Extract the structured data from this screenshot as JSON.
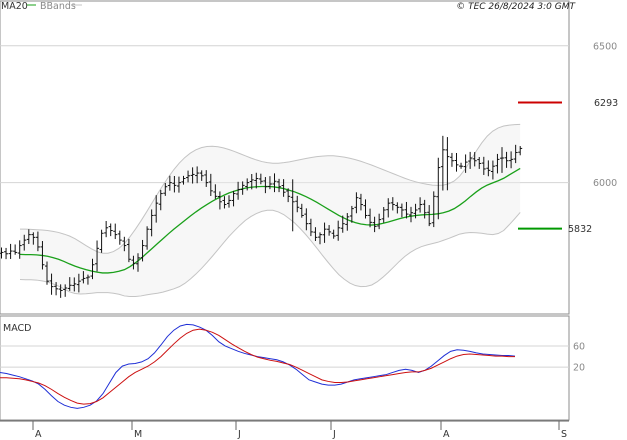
{
  "header": {
    "ma_label": "MA20",
    "bb_label": "BBands",
    "copyright": "© TEC 26/8/2024 3:0 GMT"
  },
  "colors": {
    "price": "#111111",
    "ma": "#1aa01a",
    "bands": "#c4c4c4",
    "band_fill": "#eeeeee",
    "resistance": "#cc0000",
    "support": "#009900",
    "macd": "#1f2fd6",
    "signal": "#cc1111",
    "grid": "#d4d4d4"
  },
  "chart_data": [
    {
      "type": "ohlc",
      "title": "",
      "y_ticks": [
        "6500",
        "6000"
      ],
      "ylim": [
        5520,
        6660
      ],
      "x_ticks": [
        "A",
        "M",
        "J",
        "J",
        "A",
        "S"
      ],
      "levels": [
        {
          "label": "6293",
          "value": 6293,
          "kind": "resistance"
        },
        {
          "label": "5832",
          "value": 5832,
          "kind": "support"
        }
      ],
      "series": [
        {
          "name": "price",
          "values": [
            5745,
            5740,
            5750,
            5745,
            5770,
            5790,
            5810,
            5800,
            5765,
            5700,
            5640,
            5620,
            5612,
            5606,
            5615,
            5625,
            5630,
            5640,
            5650,
            5655,
            5700,
            5760,
            5815,
            5835,
            5825,
            5810,
            5790,
            5770,
            5720,
            5705,
            5725,
            5770,
            5830,
            5880,
            5925,
            5960,
            5985,
            6000,
            5990,
            6000,
            6015,
            6025,
            6030,
            6035,
            6025,
            6000,
            5970,
            5950,
            5930,
            5920,
            5935,
            5960,
            5975,
            5990,
            6000,
            6010,
            6015,
            6005,
            5985,
            5995,
            6005,
            5985,
            5965,
            5950,
            5930,
            5910,
            5880,
            5850,
            5820,
            5800,
            5810,
            5830,
            5820,
            5805,
            5835,
            5850,
            5875,
            5905,
            5945,
            5920,
            5880,
            5855,
            5840,
            5865,
            5900,
            5925,
            5920,
            5910,
            5900,
            5885,
            5890,
            5900,
            5920,
            5890,
            5850,
            5950,
            6055,
            6120,
            6095,
            6080,
            6065,
            6060,
            6075,
            6090,
            6080,
            6070,
            6050,
            6045,
            6060,
            6085,
            6090,
            6080,
            6085,
            6110,
            6125
          ]
        },
        {
          "name": "MA20",
          "values": [
            5738,
            5737,
            5737,
            5736,
            5734,
            5731,
            5726,
            5720,
            5712,
            5703,
            5695,
            5688,
            5682,
            5677,
            5673,
            5670,
            5670,
            5672,
            5676,
            5682,
            5693,
            5707,
            5723,
            5741,
            5759,
            5777,
            5795,
            5813,
            5830,
            5846,
            5862,
            5878,
            5893,
            5907,
            5920,
            5932,
            5943,
            5953,
            5962,
            5969,
            5975,
            5980,
            5983,
            5985,
            5986,
            5986,
            5985,
            5982,
            5978,
            5972,
            5966,
            5958,
            5949,
            5939,
            5928,
            5916,
            5904,
            5892,
            5880,
            5870,
            5861,
            5854,
            5849,
            5846,
            5845,
            5847,
            5851,
            5856,
            5862,
            5868,
            5873,
            5877,
            5880,
            5882,
            5883,
            5884,
            5886,
            5890,
            5896,
            5905,
            5918,
            5933,
            5950,
            5966,
            5980,
            5991,
            5999,
            6007,
            6016,
            6028,
            6040,
            6052
          ]
        },
        {
          "name": "upper_band",
          "values": [
            5830,
            5830,
            5829,
            5828,
            5827,
            5825,
            5822,
            5818,
            5812,
            5805,
            5795,
            5783,
            5770,
            5758,
            5748,
            5742,
            5742,
            5748,
            5760,
            5778,
            5802,
            5830,
            5860,
            5892,
            5925,
            5958,
            5990,
            6020,
            6048,
            6072,
            6092,
            6108,
            6120,
            6128,
            6132,
            6133,
            6131,
            6127,
            6121,
            6114,
            6106,
            6098,
            6090,
            6083,
            6077,
            6073,
            6071,
            6071,
            6073,
            6076,
            6080,
            6084,
            6088,
            6092,
            6095,
            6097,
            6098,
            6098,
            6096,
            6093,
            6089,
            6084,
            6078,
            6071,
            6064,
            6056,
            6048,
            6040,
            6032,
            6024,
            6016,
            6009,
            6003,
            5998,
            5994,
            5991,
            5990,
            5991,
            5996,
            6006,
            6024,
            6050,
            6082,
            6115,
            6145,
            6170,
            6188,
            6200,
            6207,
            6210,
            6212,
            6213
          ]
        },
        {
          "name": "lower_band",
          "values": [
            5646,
            5645,
            5645,
            5644,
            5641,
            5637,
            5630,
            5622,
            5612,
            5601,
            5595,
            5593,
            5594,
            5596,
            5598,
            5598,
            5598,
            5596,
            5592,
            5586,
            5584,
            5584,
            5586,
            5590,
            5593,
            5596,
            5600,
            5606,
            5612,
            5620,
            5632,
            5648,
            5666,
            5686,
            5708,
            5731,
            5755,
            5779,
            5803,
            5824,
            5844,
            5862,
            5876,
            5887,
            5895,
            5899,
            5899,
            5893,
            5883,
            5868,
            5852,
            5832,
            5810,
            5786,
            5761,
            5735,
            5710,
            5686,
            5664,
            5647,
            5633,
            5624,
            5620,
            5621,
            5626,
            5638,
            5654,
            5672,
            5692,
            5712,
            5730,
            5745,
            5757,
            5766,
            5772,
            5777,
            5782,
            5789,
            5796,
            5804,
            5812,
            5816,
            5818,
            5817,
            5815,
            5812,
            5810,
            5814,
            5825,
            5846,
            5868,
            5891
          ]
        }
      ]
    },
    {
      "type": "line",
      "title": "MACD",
      "y_ticks": [
        "60",
        "20"
      ],
      "ylim": [
        -80,
        115
      ],
      "series": [
        {
          "name": "MACD",
          "values": [
            10,
            8,
            5,
            2,
            -2,
            -6,
            -12,
            -22,
            -34,
            -45,
            -52,
            -56,
            -58,
            -56,
            -52,
            -44,
            -30,
            -10,
            10,
            22,
            26,
            27,
            30,
            36,
            47,
            62,
            78,
            90,
            98,
            101,
            100,
            96,
            90,
            80,
            68,
            60,
            55,
            50,
            46,
            43,
            40,
            38,
            36,
            34,
            30,
            24,
            16,
            6,
            -4,
            -8,
            -12,
            -14,
            -14,
            -12,
            -8,
            -4,
            -2,
            0,
            2,
            4,
            6,
            10,
            14,
            16,
            14,
            10,
            14,
            22,
            32,
            42,
            50,
            53,
            52,
            50,
            47,
            45,
            44,
            43,
            42,
            42,
            41
          ]
        },
        {
          "name": "Signal",
          "values": [
            0,
            0,
            -1,
            -2,
            -4,
            -7,
            -10,
            -15,
            -22,
            -30,
            -37,
            -43,
            -48,
            -50,
            -49,
            -45,
            -38,
            -28,
            -18,
            -8,
            2,
            10,
            16,
            22,
            30,
            40,
            52,
            64,
            75,
            84,
            90,
            92,
            90,
            86,
            80,
            72,
            64,
            57,
            50,
            44,
            39,
            36,
            33,
            31,
            28,
            25,
            20,
            14,
            8,
            2,
            -4,
            -7,
            -9,
            -9,
            -8,
            -6,
            -4,
            -2,
            0,
            2,
            4,
            6,
            8,
            10,
            11,
            11,
            14,
            18,
            24,
            30,
            36,
            41,
            44,
            45,
            44,
            43,
            42,
            41,
            41,
            40,
            40
          ]
        }
      ]
    }
  ]
}
